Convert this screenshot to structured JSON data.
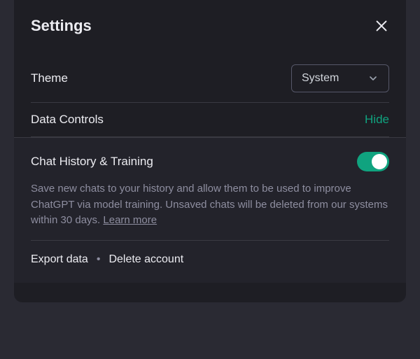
{
  "modal": {
    "title": "Settings"
  },
  "theme": {
    "label": "Theme",
    "selected": "System"
  },
  "data_controls": {
    "label": "Data Controls",
    "toggle_text": "Hide"
  },
  "history": {
    "title": "Chat History & Training",
    "enabled": true,
    "description": "Save new chats to your history and allow them to be used to improve ChatGPT via model training. Unsaved chats will be deleted from our systems within 30 days. ",
    "learn_more": "Learn more"
  },
  "actions": {
    "export": "Export data",
    "separator": "•",
    "delete": "Delete account"
  },
  "colors": {
    "accent": "#10a37f"
  }
}
